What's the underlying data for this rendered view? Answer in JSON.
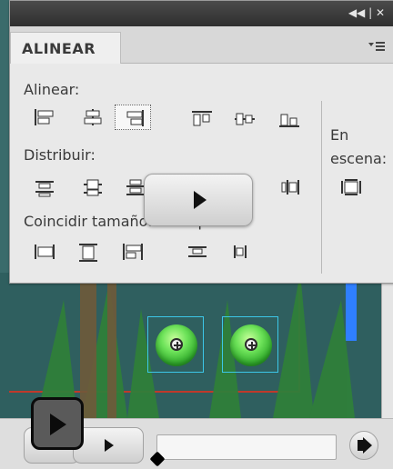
{
  "panel": {
    "tab_title": "ALINEAR",
    "window_controls_text": "◀◀ | ✕",
    "menu_icon": "menu-icon",
    "sections": {
      "align_label": "Alinear:",
      "distribute_label": "Distribuir:",
      "match_size_label": "Coincidir tamaño:",
      "space_label": "Espacio:",
      "stage_label_1": "En",
      "stage_label_2": "escena:"
    }
  },
  "overlay": {
    "play_icon": "play-icon"
  },
  "player": {
    "volume_icon": "volume-icon",
    "timeline_progress": 0.0
  }
}
